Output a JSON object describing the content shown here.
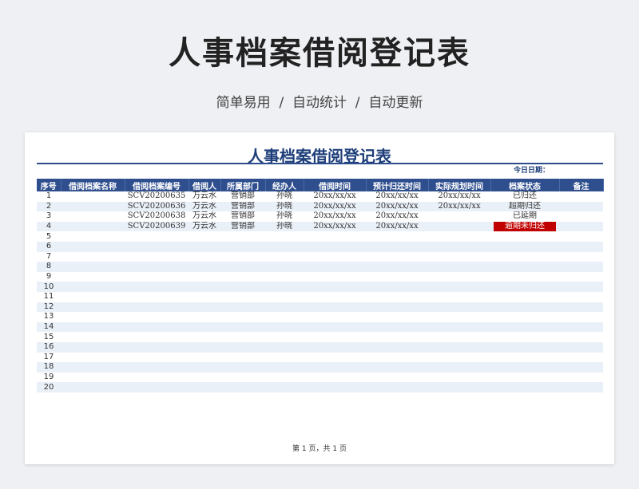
{
  "hero": {
    "title": "人事档案借阅登记表",
    "subtitle": "简单易用  /  自动统计  /  自动更新"
  },
  "sheet": {
    "title": "人事档案借阅登记表",
    "date_label": "今日日期：",
    "footer": "第 1 页，共 1 页",
    "colors": {
      "header_bg": "#2e4e8e",
      "stripe": "#eaf0f8",
      "title": "#1f3f7a",
      "overdue": "#c00000"
    }
  },
  "table": {
    "headers": [
      "序号",
      "借阅档案名称",
      "借阅档案编号",
      "借阅人",
      "所属部门",
      "经办人",
      "借阅时间",
      "预计归还时间",
      "实际规划时间",
      "档案状态",
      "备注"
    ],
    "rows": [
      {
        "no": "1",
        "name": "",
        "code": "SCV20200635",
        "borrower": "万云水",
        "dept": "营销部",
        "handler": "孙晓",
        "borrow_time": "20xx/xx/xx",
        "due_time": "20xx/xx/xx",
        "actual_time": "20xx/xx/xx",
        "status": "已归还",
        "note": ""
      },
      {
        "no": "2",
        "name": "",
        "code": "SCV20200636",
        "borrower": "万云水",
        "dept": "营销部",
        "handler": "孙晓",
        "borrow_time": "20xx/xx/xx",
        "due_time": "20xx/xx/xx",
        "actual_time": "20xx/xx/xx",
        "status": "超期归还",
        "note": ""
      },
      {
        "no": "3",
        "name": "",
        "code": "SCV20200638",
        "borrower": "万云水",
        "dept": "营销部",
        "handler": "孙晓",
        "borrow_time": "20xx/xx/xx",
        "due_time": "20xx/xx/xx",
        "actual_time": "",
        "status": "已延期",
        "note": ""
      },
      {
        "no": "4",
        "name": "",
        "code": "SCV20200639",
        "borrower": "万云水",
        "dept": "营销部",
        "handler": "孙晓",
        "borrow_time": "20xx/xx/xx",
        "due_time": "20xx/xx/xx",
        "actual_time": "",
        "status": "逾期未归还",
        "note": ""
      },
      {
        "no": "5",
        "name": "",
        "code": "",
        "borrower": "",
        "dept": "",
        "handler": "",
        "borrow_time": "",
        "due_time": "",
        "actual_time": "",
        "status": "",
        "note": ""
      },
      {
        "no": "6",
        "name": "",
        "code": "",
        "borrower": "",
        "dept": "",
        "handler": "",
        "borrow_time": "",
        "due_time": "",
        "actual_time": "",
        "status": "",
        "note": ""
      },
      {
        "no": "7",
        "name": "",
        "code": "",
        "borrower": "",
        "dept": "",
        "handler": "",
        "borrow_time": "",
        "due_time": "",
        "actual_time": "",
        "status": "",
        "note": ""
      },
      {
        "no": "8",
        "name": "",
        "code": "",
        "borrower": "",
        "dept": "",
        "handler": "",
        "borrow_time": "",
        "due_time": "",
        "actual_time": "",
        "status": "",
        "note": ""
      },
      {
        "no": "9",
        "name": "",
        "code": "",
        "borrower": "",
        "dept": "",
        "handler": "",
        "borrow_time": "",
        "due_time": "",
        "actual_time": "",
        "status": "",
        "note": ""
      },
      {
        "no": "10",
        "name": "",
        "code": "",
        "borrower": "",
        "dept": "",
        "handler": "",
        "borrow_time": "",
        "due_time": "",
        "actual_time": "",
        "status": "",
        "note": ""
      },
      {
        "no": "11",
        "name": "",
        "code": "",
        "borrower": "",
        "dept": "",
        "handler": "",
        "borrow_time": "",
        "due_time": "",
        "actual_time": "",
        "status": "",
        "note": ""
      },
      {
        "no": "12",
        "name": "",
        "code": "",
        "borrower": "",
        "dept": "",
        "handler": "",
        "borrow_time": "",
        "due_time": "",
        "actual_time": "",
        "status": "",
        "note": ""
      },
      {
        "no": "13",
        "name": "",
        "code": "",
        "borrower": "",
        "dept": "",
        "handler": "",
        "borrow_time": "",
        "due_time": "",
        "actual_time": "",
        "status": "",
        "note": ""
      },
      {
        "no": "14",
        "name": "",
        "code": "",
        "borrower": "",
        "dept": "",
        "handler": "",
        "borrow_time": "",
        "due_time": "",
        "actual_time": "",
        "status": "",
        "note": ""
      },
      {
        "no": "15",
        "name": "",
        "code": "",
        "borrower": "",
        "dept": "",
        "handler": "",
        "borrow_time": "",
        "due_time": "",
        "actual_time": "",
        "status": "",
        "note": ""
      },
      {
        "no": "16",
        "name": "",
        "code": "",
        "borrower": "",
        "dept": "",
        "handler": "",
        "borrow_time": "",
        "due_time": "",
        "actual_time": "",
        "status": "",
        "note": ""
      },
      {
        "no": "17",
        "name": "",
        "code": "",
        "borrower": "",
        "dept": "",
        "handler": "",
        "borrow_time": "",
        "due_time": "",
        "actual_time": "",
        "status": "",
        "note": ""
      },
      {
        "no": "18",
        "name": "",
        "code": "",
        "borrower": "",
        "dept": "",
        "handler": "",
        "borrow_time": "",
        "due_time": "",
        "actual_time": "",
        "status": "",
        "note": ""
      },
      {
        "no": "19",
        "name": "",
        "code": "",
        "borrower": "",
        "dept": "",
        "handler": "",
        "borrow_time": "",
        "due_time": "",
        "actual_time": "",
        "status": "",
        "note": ""
      },
      {
        "no": "20",
        "name": "",
        "code": "",
        "borrower": "",
        "dept": "",
        "handler": "",
        "borrow_time": "",
        "due_time": "",
        "actual_time": "",
        "status": "",
        "note": ""
      }
    ]
  }
}
